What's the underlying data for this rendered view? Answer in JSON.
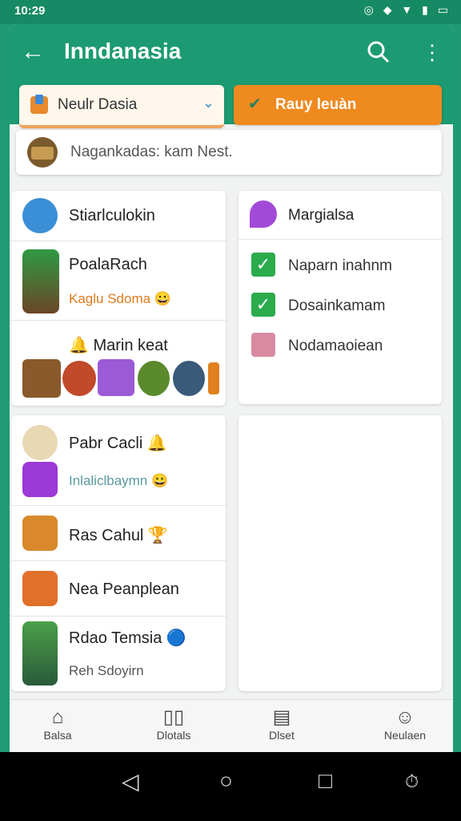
{
  "status_bar": {
    "time": "10:29",
    "icons": "◎ ◆ ▼ ▮ ▭"
  },
  "app_bar": {
    "title": "Inndanasia"
  },
  "selector": {
    "label": "Neulr Dasia"
  },
  "action_button": {
    "label": "Rauy leuàn"
  },
  "notice": {
    "text": "Nagankadas: kam Nest."
  },
  "left_card_top": {
    "rows": [
      {
        "name": "Stiarlculokin"
      },
      {
        "name": "PoalaRach",
        "sub": "Kaglu Sdoma 😀"
      },
      {
        "name": "🔔 Marin keat"
      }
    ]
  },
  "left_card_bottom": {
    "rows": [
      {
        "name": "Pabr Cacli 🔔"
      },
      {
        "sub": "Inlaliclbaymn 😀"
      },
      {
        "name": "Ras Cahul 🏆"
      },
      {
        "name": "Nea Peanplean"
      },
      {
        "name": "Rdao Temsia 🔵",
        "sub": "Reh Sdoyirn"
      }
    ]
  },
  "right_card": {
    "header": "Margialsa",
    "items": [
      "Naparn inahnm",
      "Dosainkamam",
      "Nodamaoiean"
    ]
  },
  "bottom_nav": [
    "Balsa",
    "Dlotals",
    "Dlset",
    "Neulaen"
  ],
  "colors": {
    "primary": "#1c9a72",
    "accent": "#ef8a1f",
    "check": "#2bab4c"
  }
}
